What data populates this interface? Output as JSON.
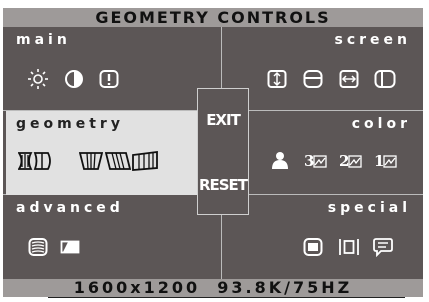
{
  "title": "GEOMETRY CONTROLS",
  "status": "1600x1200  93.8K/75HZ",
  "colors": {
    "panel_bg": "#5c5656",
    "active_panel_bg": "#e1e1e1",
    "bar_bg": "#9e9a99",
    "text_light": "#ffffff",
    "text_dark": "#222222"
  },
  "sections": {
    "main": {
      "label": "main",
      "icons": [
        "brightness-icon",
        "contrast-icon",
        "info-icon"
      ]
    },
    "screen": {
      "label": "screen",
      "icons": [
        "vertical-size-icon",
        "vertical-position-icon",
        "horizontal-size-icon",
        "horizontal-position-icon"
      ]
    },
    "geometry": {
      "label": "geometry",
      "selected": true,
      "icons": [
        "pincushion-icon",
        "trapezoid-icon",
        "parallelogram-icon",
        "rotation-icon"
      ]
    },
    "color": {
      "label": "color",
      "icons": [
        "user-color-icon",
        "preset-3-icon",
        "preset-2-icon",
        "preset-1-icon"
      ],
      "preset_numbers": [
        "3",
        "2",
        "1"
      ]
    },
    "advanced": {
      "label": "advanced",
      "icons": [
        "moire-icon",
        "degauss-icon"
      ]
    },
    "special": {
      "label": "special",
      "icons": [
        "recall-icon",
        "focus-icon",
        "language-icon"
      ]
    }
  },
  "buttons": {
    "exit": "EXIT",
    "reset": "RESET"
  }
}
